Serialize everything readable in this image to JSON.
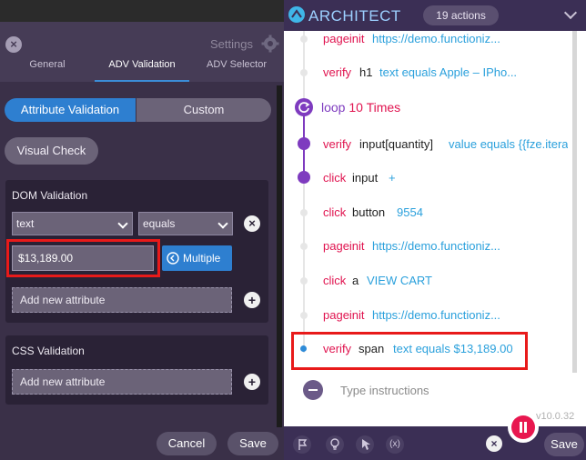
{
  "left": {
    "settings_label": "Settings",
    "tabs": [
      {
        "label": "General"
      },
      {
        "label": "ADV Validation",
        "active": true
      },
      {
        "label": "ADV Selector"
      }
    ],
    "segments": {
      "attribute_validation": "Attribute Validation",
      "custom": "Custom",
      "selected": "Attribute Validation"
    },
    "visual_check": "Visual Check",
    "dom_validation": {
      "title": "DOM Validation",
      "attribute_select": "text",
      "operator_select": "equals",
      "value": "$13,189.00",
      "multiple_label": "Multiple",
      "add_attribute": "Add new attribute"
    },
    "css_validation": {
      "title": "CSS Validation",
      "add_attribute": "Add new attribute"
    },
    "footer": {
      "cancel": "Cancel",
      "save": "Save"
    }
  },
  "right": {
    "title": "ARCHITECT",
    "actions_count": "19 actions",
    "steps": [
      {
        "kw": "pageinit",
        "target": "",
        "value": "https://demo.functioniz..."
      },
      {
        "kw": "verify",
        "target": "h1",
        "value": "text equals Apple – IPho..."
      },
      {
        "kw": "verify",
        "target": "input[quantity]",
        "value": "value equals {{fze.itera"
      },
      {
        "kw": "click",
        "target": "input",
        "value": "+"
      },
      {
        "kw": "click",
        "target": "button",
        "value": "9554"
      },
      {
        "kw": "pageinit",
        "target": "",
        "value": "https://demo.functioniz..."
      },
      {
        "kw": "click",
        "target": "a",
        "value": "VIEW CART"
      },
      {
        "kw": "pageinit",
        "target": "",
        "value": "https://demo.functioniz..."
      },
      {
        "kw": "verify",
        "target": "span",
        "value": "text equals $13,189.00"
      }
    ],
    "loop": {
      "label": "loop",
      "count": "10 Times"
    },
    "type_placeholder": "Type instructions",
    "version": "v10.0.32",
    "footer_icons": [
      "flag-icon",
      "bulb-icon",
      "pointer-icon",
      "variable-icon"
    ],
    "footer_var_label": "(x)",
    "save": "Save"
  }
}
